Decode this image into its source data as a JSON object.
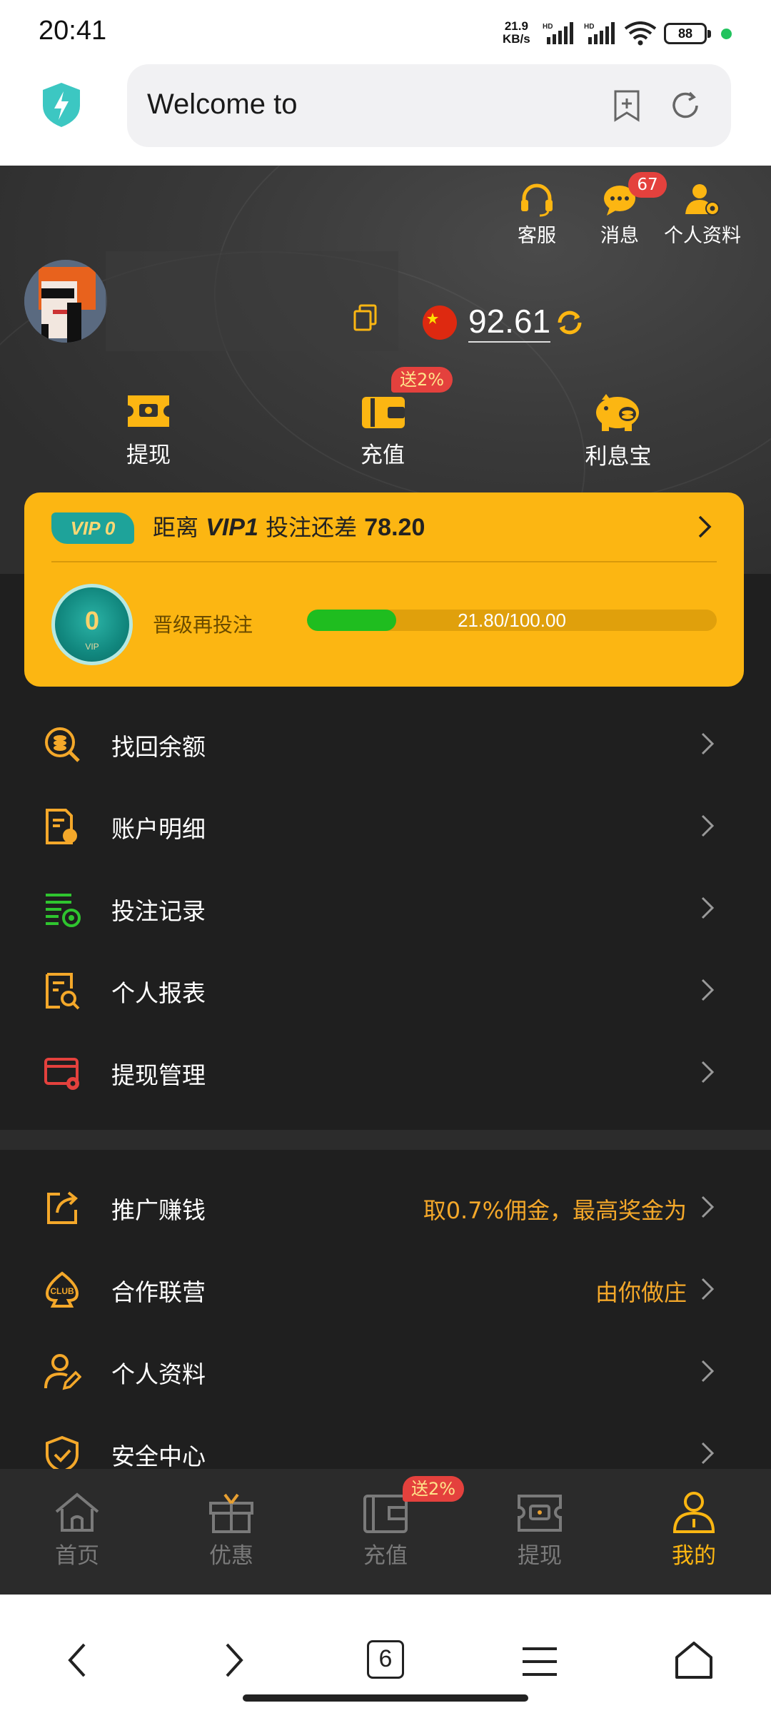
{
  "status_bar": {
    "time": "20:41",
    "net_speed": "21.9",
    "net_unit": "KB/s",
    "battery": "88"
  },
  "browser": {
    "url_text": "Welcome to",
    "tab_count": "6"
  },
  "header": {
    "actions": [
      {
        "label": "客服",
        "icon": "headset-icon"
      },
      {
        "label": "消息",
        "icon": "message-icon",
        "badge": "67"
      },
      {
        "label": "个人资料",
        "icon": "user-settings-icon"
      }
    ],
    "balance": "92.61",
    "quick_actions": [
      {
        "label": "提现",
        "icon": "ticket-icon"
      },
      {
        "label": "充值",
        "icon": "wallet-icon",
        "badge": "送2%"
      },
      {
        "label": "利息宝",
        "icon": "piggy-bank-icon"
      }
    ]
  },
  "vip": {
    "level_chip": "VIP 0",
    "prefix": "距离",
    "target": "VIP1",
    "middle": "投注还差",
    "remaining": "78.20",
    "medal_level": "0",
    "medal_text": "VIP",
    "progress_label": "晋级再投注",
    "progress_text": "21.80/100.00",
    "progress_value": 21.8,
    "progress_max": 100
  },
  "menu_group1": [
    {
      "label": "找回余额",
      "icon": "search-coin-icon",
      "color": "#f4a82a"
    },
    {
      "label": "账户明细",
      "icon": "account-detail-icon",
      "color": "#f4a82a"
    },
    {
      "label": "投注记录",
      "icon": "bet-record-icon",
      "color": "#2fc52f"
    },
    {
      "label": "个人报表",
      "icon": "report-icon",
      "color": "#f4a82a"
    },
    {
      "label": "提现管理",
      "icon": "withdraw-manage-icon",
      "color": "#e4413d"
    }
  ],
  "menu_group2": [
    {
      "label": "推广赚钱",
      "icon": "share-icon",
      "extra": "取0.7%佣金，最高奖金为"
    },
    {
      "label": "合作联营",
      "icon": "club-icon",
      "extra": "由你做庄"
    },
    {
      "label": "个人资料",
      "icon": "user-edit-icon",
      "extra": ""
    },
    {
      "label": "安全中心",
      "icon": "shield-check-icon",
      "extra": ""
    }
  ],
  "tabbar": [
    {
      "label": "首页",
      "icon": "home-icon"
    },
    {
      "label": "优惠",
      "icon": "gift-icon"
    },
    {
      "label": "充值",
      "icon": "wallet-icon",
      "badge": "送2%"
    },
    {
      "label": "提现",
      "icon": "ticket-icon"
    },
    {
      "label": "我的",
      "icon": "user-icon",
      "active": true
    }
  ],
  "colors": {
    "accent": "#fcb612",
    "badge": "#e4413d",
    "progress": "#1fbd1f"
  }
}
